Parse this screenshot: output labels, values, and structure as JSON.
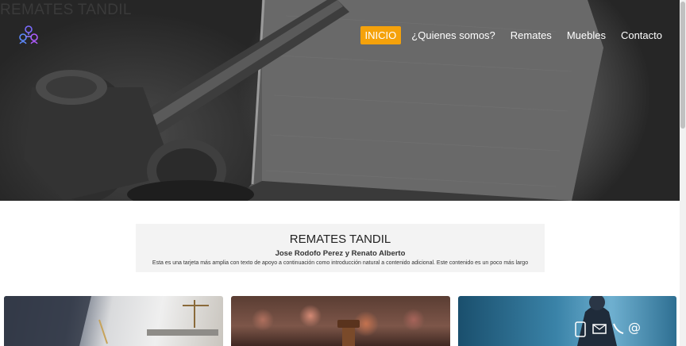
{
  "header": {
    "brand_text": "REMATES TANDIL",
    "logo_icon": "people-network-icon",
    "accent_color": "#f5a20b"
  },
  "nav": {
    "items": [
      {
        "label": "INICIO",
        "active": true
      },
      {
        "label": "¿Quienes somos?",
        "active": false
      },
      {
        "label": "Remates",
        "active": false
      },
      {
        "label": "Muebles",
        "active": false
      },
      {
        "label": "Contacto",
        "active": false
      }
    ]
  },
  "intro": {
    "title": "REMATES TANDIL",
    "subtitle": "Jose Rodofo Perez y Renato Alberto",
    "text": "Esta es una tarjeta más amplia con texto de apoyo a continuación como introducción natural a contenido adicional. Este contenido es un poco más largo"
  }
}
